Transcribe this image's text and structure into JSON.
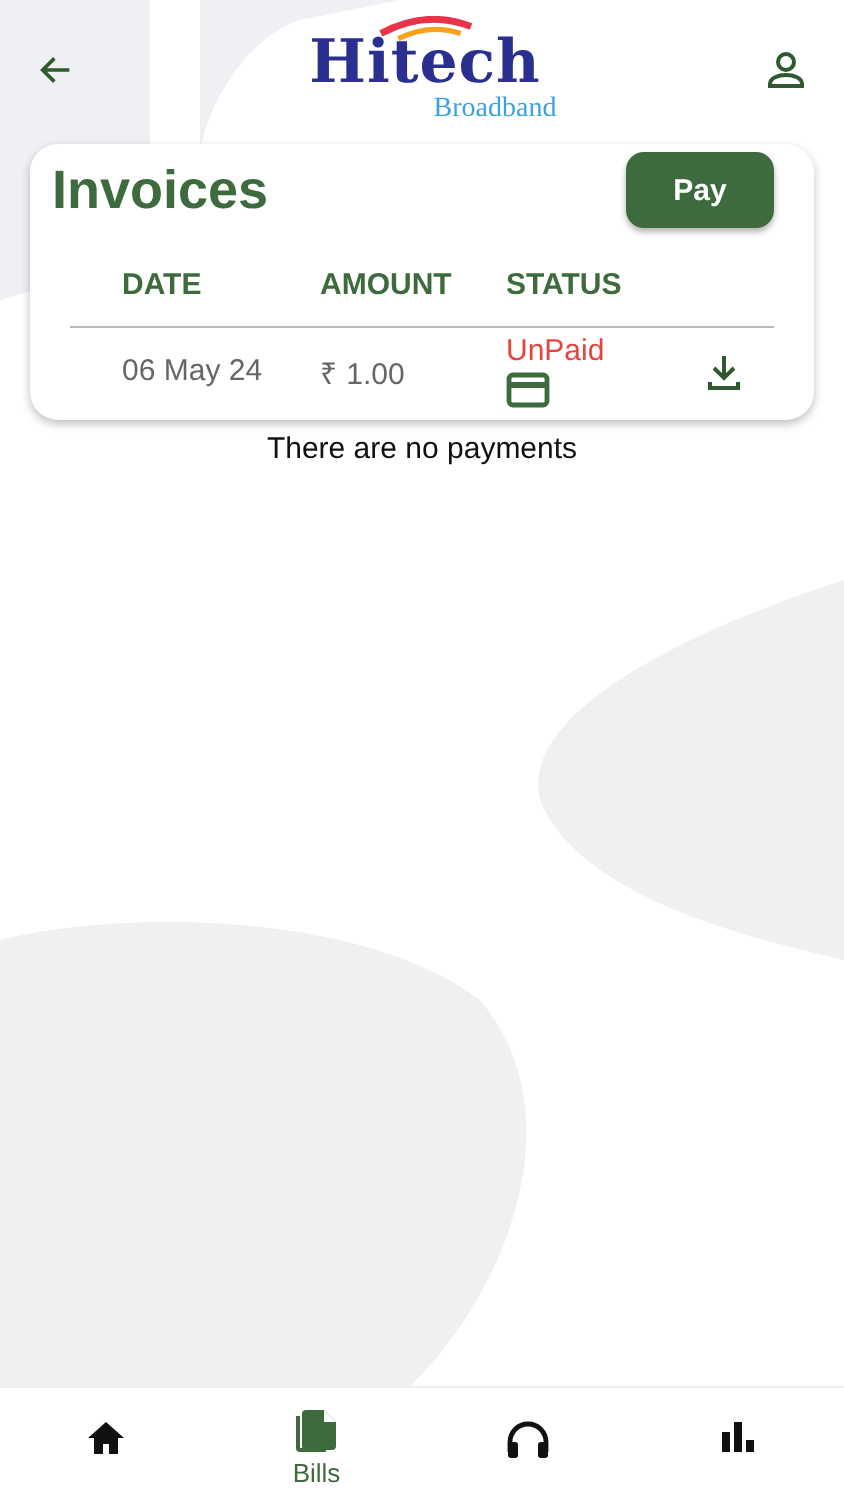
{
  "header": {
    "logo": {
      "title": "Hitech",
      "subtitle": "Broadband"
    }
  },
  "invoices": {
    "title": "Invoices",
    "pay_button": "Pay",
    "columns": [
      "DATE",
      "AMOUNT",
      "STATUS"
    ],
    "rows": [
      {
        "date": "06 May 24",
        "amount": "₹ 1.00",
        "status": "UnPaid",
        "paid": false
      }
    ]
  },
  "payments_message": "There are no payments",
  "nav": [
    {
      "kind": "home",
      "selected": false
    },
    {
      "kind": "bills",
      "label": "Bills",
      "selected": true
    },
    {
      "kind": "support",
      "selected": false
    },
    {
      "kind": "stats",
      "selected": false
    }
  ]
}
